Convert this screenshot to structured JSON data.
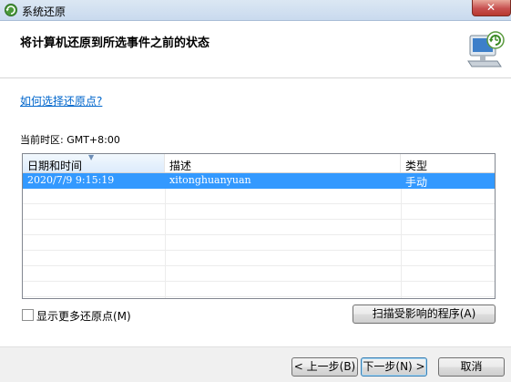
{
  "window": {
    "title": "系统还原"
  },
  "header": {
    "title": "将计算机还原到所选事件之前的状态"
  },
  "content": {
    "help_link": "如何选择还原点?",
    "timezone": "当前时区: GMT+8:00",
    "table": {
      "columns": [
        "日期和时间",
        "描述",
        "类型"
      ],
      "rows": [
        {
          "date": "2020/7/9 9:15:19",
          "description": "xitonghuanyuan",
          "type": "手动",
          "selected": true
        }
      ]
    },
    "show_more_label": "显示更多还原点(M)",
    "scan_button": "扫描受影响的程序(A)"
  },
  "footer": {
    "back_button": "< 上一步(B)",
    "next_button": "下一步(N) >",
    "cancel_button": "取消"
  },
  "colors": {
    "selection": "#3399ff",
    "link": "#0066cc",
    "close": "#c75050"
  }
}
